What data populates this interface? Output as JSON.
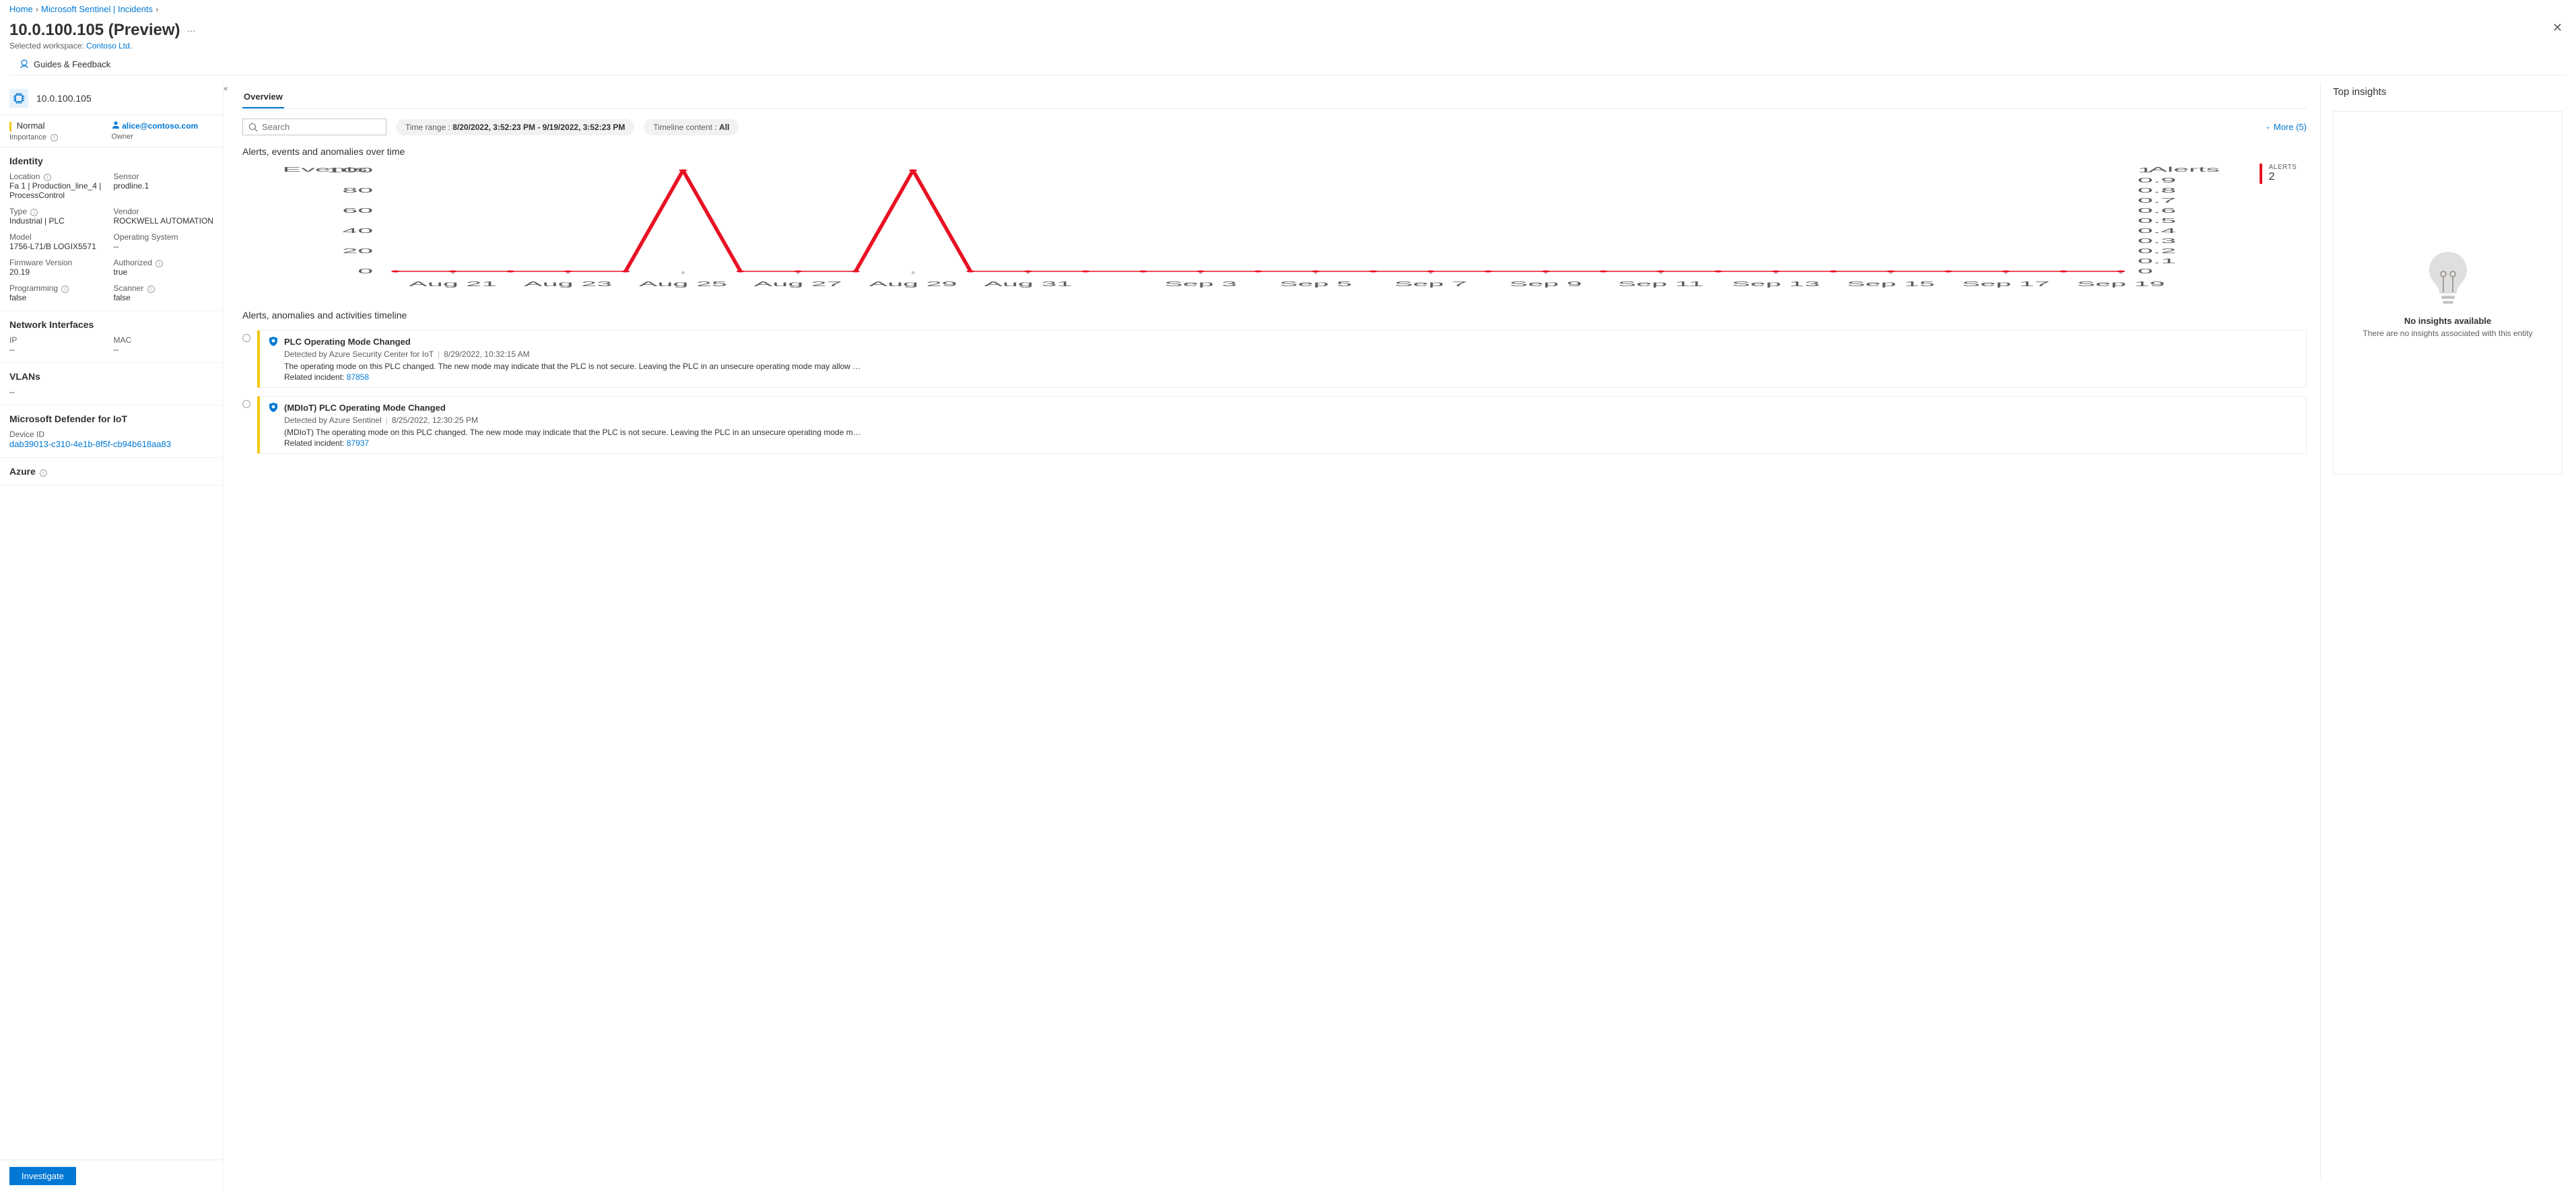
{
  "breadcrumb": {
    "home": "Home",
    "sentinel": "Microsoft Sentinel | Incidents"
  },
  "header": {
    "title": "10.0.100.105 (Preview)",
    "workspace_label": "Selected workspace:",
    "workspace": "Contoso Ltd."
  },
  "toolbar": {
    "guides": "Guides & Feedback"
  },
  "entity": {
    "name": "10.0.100.105"
  },
  "importance": {
    "level": "Normal",
    "label": "Importance"
  },
  "owner": {
    "email": "alice@contoso.com",
    "label": "Owner"
  },
  "identity": {
    "heading": "Identity",
    "location_label": "Location",
    "location": "Fa 1 | Production_line_4 | ProcessControl",
    "sensor_label": "Sensor",
    "sensor": "prodline.1",
    "type_label": "Type",
    "type": "Industrial | PLC",
    "vendor_label": "Vendor",
    "vendor": "ROCKWELL AUTOMATION",
    "model_label": "Model",
    "model": "1756-L71/B LOGIX5571",
    "os_label": "Operating System",
    "os": "--",
    "fw_label": "Firmware Version",
    "fw": "20.19",
    "auth_label": "Authorized",
    "auth": "true",
    "prog_label": "Programming",
    "prog": "false",
    "scanner_label": "Scanner",
    "scanner": "false"
  },
  "network": {
    "heading": "Network Interfaces",
    "ip_label": "IP",
    "ip": "--",
    "mac_label": "MAC",
    "mac": "--"
  },
  "vlans": {
    "heading": "VLANs",
    "value": "--"
  },
  "defender": {
    "heading": "Microsoft Defender for IoT",
    "device_id_label": "Device ID",
    "device_id": "dab39013-c310-4e1b-8f5f-cb94b618aa83"
  },
  "azure": {
    "heading": "Azure"
  },
  "investigate": "Investigate",
  "overview_tab": "Overview",
  "search_placeholder": "Search",
  "time_range": {
    "label": "Time range : ",
    "value": "8/20/2022, 3:52:23 PM - 9/19/2022, 3:52:23 PM"
  },
  "timeline_content": {
    "label": "Timeline content : ",
    "value": "All"
  },
  "more": "More (5)",
  "chart_heading": "Alerts, events and anomalies over time",
  "alerts_badge": {
    "label": "ALERTS",
    "count": "2"
  },
  "timeline_heading": "Alerts, anomalies and activities timeline",
  "timeline": [
    {
      "title": "PLC Operating Mode Changed",
      "source": "Detected by Azure Security Center for IoT",
      "time": "8/29/2022, 10:32:15 AM",
      "desc": "The operating mode on this PLC changed. The new mode may indicate that the PLC is not secure. Leaving the PLC in an unsecure operating mode may allow …",
      "related_label": "Related incident: ",
      "related": "87858"
    },
    {
      "title": "(MDIoT) PLC Operating Mode Changed",
      "source": "Detected by Azure Sentinel",
      "time": "8/25/2022, 12:30:25 PM",
      "desc": "(MDIoT) The operating mode on this PLC changed. The new mode may indicate that the PLC is not secure. Leaving the PLC in an unsecure operating mode m…",
      "related_label": "Related incident: ",
      "related": "87937"
    }
  ],
  "insights": {
    "heading": "Top insights",
    "none_title": "No insights available",
    "none_desc": "There are no insights associated with this entity"
  },
  "chart_data": {
    "type": "line",
    "title": "Alerts, events and anomalies over time",
    "left_axis_label": "Events",
    "right_axis_label": "Alerts",
    "ylim_left": [
      0,
      100
    ],
    "ylim_right": [
      0,
      1
    ],
    "y_ticks_left": [
      0,
      20,
      40,
      60,
      80,
      100
    ],
    "y_ticks_right": [
      0,
      0.1,
      0.2,
      0.3,
      0.4,
      0.5,
      0.6,
      0.7,
      0.8,
      0.9,
      1
    ],
    "x_ticks": [
      "Aug 21",
      "Aug 23",
      "Aug 25",
      "Aug 27",
      "Aug 29",
      "Aug 31",
      "Sep 3",
      "Sep 5",
      "Sep 7",
      "Sep 9",
      "Sep 11",
      "Sep 13",
      "Sep 15",
      "Sep 17",
      "Sep 19"
    ],
    "series": [
      {
        "name": "events",
        "color": "#e81123",
        "x": [
          "Aug 20",
          "Aug 21",
          "Aug 22",
          "Aug 23",
          "Aug 24",
          "Aug 25",
          "Aug 26",
          "Aug 27",
          "Aug 28",
          "Aug 29",
          "Aug 30",
          "Aug 31",
          "Sep 1",
          "Sep 2",
          "Sep 3",
          "Sep 4",
          "Sep 5",
          "Sep 6",
          "Sep 7",
          "Sep 8",
          "Sep 9",
          "Sep 10",
          "Sep 11",
          "Sep 12",
          "Sep 13",
          "Sep 14",
          "Sep 15",
          "Sep 16",
          "Sep 17",
          "Sep 18",
          "Sep 19"
        ],
        "values": [
          0,
          0,
          0,
          0,
          0,
          100,
          0,
          0,
          0,
          100,
          0,
          0,
          0,
          0,
          0,
          0,
          0,
          0,
          0,
          0,
          0,
          0,
          0,
          0,
          0,
          0,
          0,
          0,
          0,
          0,
          0
        ]
      }
    ]
  }
}
